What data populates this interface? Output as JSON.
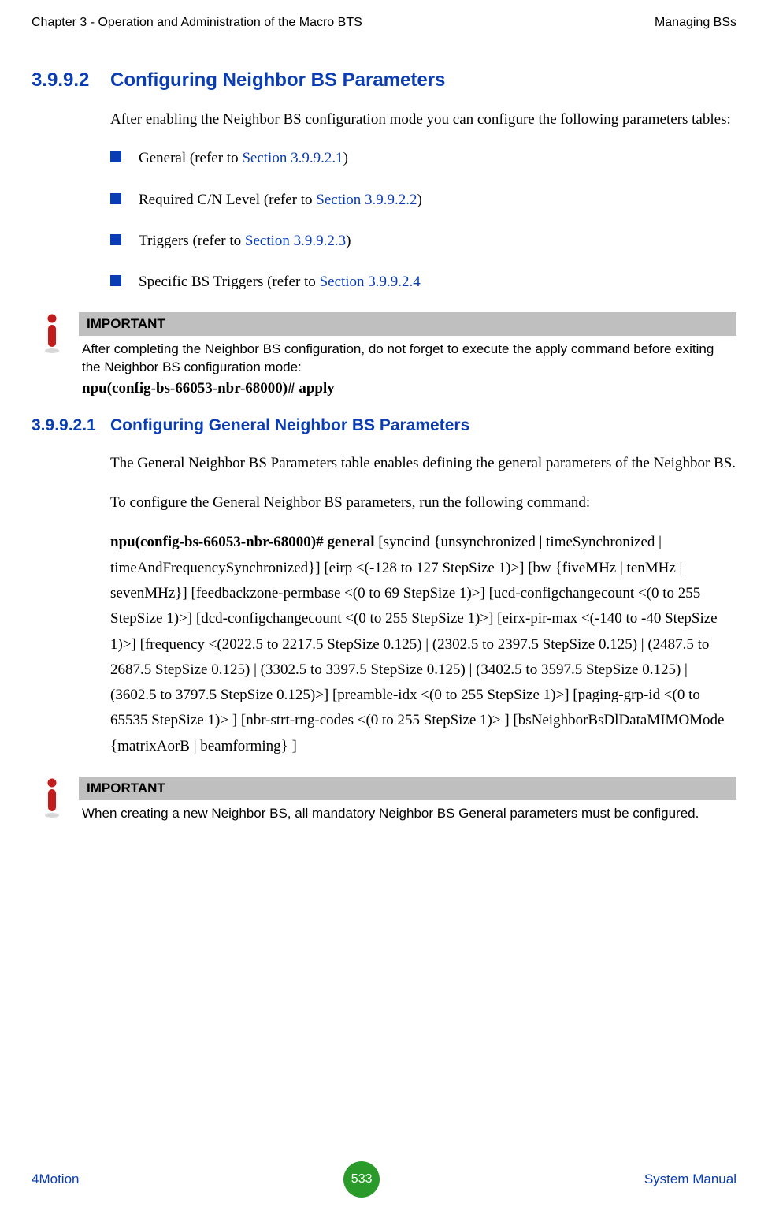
{
  "header": {
    "left": "Chapter 3 - Operation and Administration of the Macro BTS",
    "right": "Managing BSs"
  },
  "sec1": {
    "num": "3.9.9.2",
    "title": "Configuring Neighbor BS Parameters",
    "intro": "After enabling the Neighbor BS configuration mode you can configure the following parameters tables:",
    "bullets": [
      {
        "pre": "General (refer to ",
        "link": "Section 3.9.9.2.1",
        "post": ")"
      },
      {
        "pre": "Required C/N Level (refer to ",
        "link": "Section 3.9.9.2.2",
        "post": ")"
      },
      {
        "pre": "Triggers (refer to ",
        "link": "Section 3.9.9.2.3",
        "post": ")"
      },
      {
        "pre": "Specific BS Triggers (refer to ",
        "link": "Section 3.9.9.2.4",
        "post": ""
      }
    ]
  },
  "important1": {
    "label": "IMPORTANT",
    "text": "After completing the Neighbor BS configuration, do not forget to execute the apply command before exiting the Neighbor BS configuration mode:",
    "cmd": "npu(config-bs-66053-nbr-68000)# apply"
  },
  "sec2": {
    "num": "3.9.9.2.1",
    "title": "Configuring General Neighbor BS Parameters",
    "p1": "The General Neighbor BS Parameters table enables defining the general parameters of the Neighbor BS.",
    "p2": "To configure the General Neighbor BS parameters, run the following command:",
    "cmd_bold": "npu(config-bs-66053-nbr-68000)# general",
    "cmd_rest": " [syncind {unsynchronized | timeSynchronized | timeAndFrequencySynchronized}] [eirp <(-128 to 127 StepSize 1)>] [bw {fiveMHz | tenMHz | sevenMHz}] [feedbackzone-permbase <(0 to 69 StepSize 1)>] [ucd-configchangecount <(0 to 255 StepSize 1)>] [dcd-configchangecount <(0 to 255 StepSize 1)>] [eirx-pir-max <(-140 to -40 StepSize 1)>] [frequency <(2022.5 to 2217.5 StepSize 0.125) | (2302.5 to 2397.5 StepSize 0.125) | (2487.5 to 2687.5 StepSize 0.125) | (3302.5 to 3397.5 StepSize 0.125) | (3402.5 to 3597.5 StepSize 0.125) | (3602.5 to 3797.5 StepSize 0.125)>] [preamble-idx <(0 to 255 StepSize 1)>] [paging-grp-id <(0 to 65535 StepSize 1)> ] [nbr-strt-rng-codes <(0 to 255 StepSize 1)> ] [bsNeighborBsDlDataMIMOMode {matrixAorB | beamforming} ]"
  },
  "important2": {
    "label": "IMPORTANT",
    "text": "When creating a new Neighbor BS, all mandatory Neighbor BS General parameters must be configured."
  },
  "footer": {
    "left": "4Motion",
    "page": "533",
    "right": "System Manual"
  }
}
